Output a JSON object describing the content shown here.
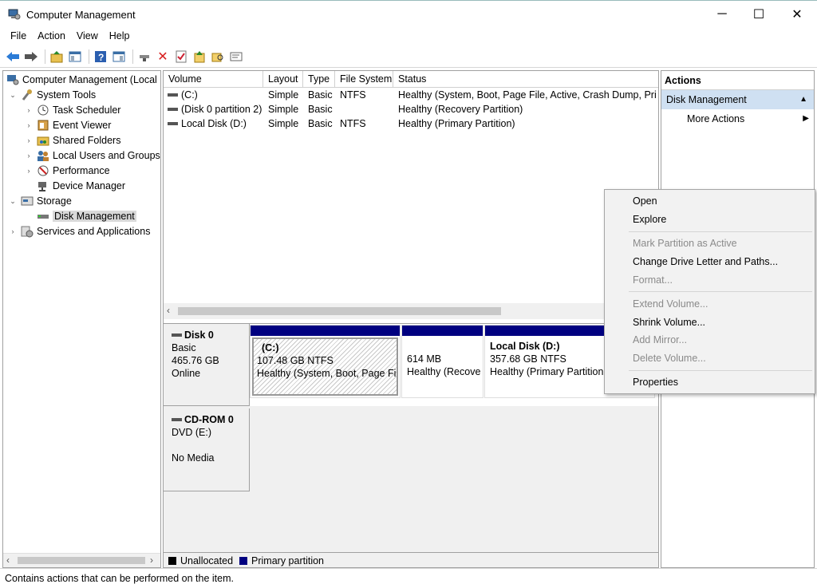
{
  "window": {
    "title": "Computer Management",
    "controls": {
      "minimize": "─",
      "maximize": "☐",
      "close": "✕"
    }
  },
  "menu": [
    "File",
    "Action",
    "View",
    "Help"
  ],
  "tree": {
    "root": "Computer Management (Local",
    "items": [
      {
        "label": "System Tools",
        "expander": "⌄",
        "icon": "tools-icon"
      },
      {
        "label": "Task Scheduler",
        "expander": "›",
        "icon": "clock-icon"
      },
      {
        "label": "Event Viewer",
        "expander": "›",
        "icon": "event-log-icon"
      },
      {
        "label": "Shared Folders",
        "expander": "›",
        "icon": "shared-folder-icon"
      },
      {
        "label": "Local Users and Groups",
        "expander": "›",
        "icon": "users-icon"
      },
      {
        "label": "Performance",
        "expander": "›",
        "icon": "performance-icon"
      },
      {
        "label": "Device Manager",
        "expander": "",
        "icon": "device-manager-icon"
      },
      {
        "label": "Storage",
        "expander": "⌄",
        "icon": "storage-icon"
      },
      {
        "label": "Disk Management",
        "expander": "",
        "icon": "disk-icon"
      },
      {
        "label": "Services and Applications",
        "expander": "›",
        "icon": "services-icon"
      }
    ]
  },
  "volume_table": {
    "columns": [
      "Volume",
      "Layout",
      "Type",
      "File System",
      "Status"
    ],
    "rows": [
      {
        "volume": "(C:)",
        "layout": "Simple",
        "type": "Basic",
        "fs": "NTFS",
        "status": "Healthy (System, Boot, Page File, Active, Crash Dump, Prim"
      },
      {
        "volume": "(Disk 0 partition 2)",
        "layout": "Simple",
        "type": "Basic",
        "fs": "",
        "status": "Healthy (Recovery Partition)"
      },
      {
        "volume": "Local Disk (D:)",
        "layout": "Simple",
        "type": "Basic",
        "fs": "NTFS",
        "status": "Healthy (Primary Partition)"
      }
    ]
  },
  "disks": [
    {
      "name": "Disk 0",
      "type": "Basic",
      "size": "465.76 GB",
      "state": "Online",
      "partitions": [
        {
          "title": "(C:)",
          "size": "107.48 GB NTFS",
          "status": "Healthy (System, Boot, Page File"
        },
        {
          "title": "",
          "size": "614 MB",
          "status": "Healthy (Recove"
        },
        {
          "title": "Local Disk  (D:)",
          "size": "357.68 GB NTFS",
          "status": "Healthy (Primary Partition"
        }
      ]
    },
    {
      "name": "CD-ROM 0",
      "type": "DVD (E:)",
      "size": "",
      "state": "No Media"
    }
  ],
  "legend": [
    {
      "label": "Unallocated",
      "color": "#000000"
    },
    {
      "label": "Primary partition",
      "color": "#000080"
    }
  ],
  "actions": {
    "header": "Actions",
    "section": "Disk Management",
    "more": "More Actions"
  },
  "context_menu": {
    "items": [
      {
        "label": "Open",
        "enabled": true
      },
      {
        "label": "Explore",
        "enabled": true
      },
      {
        "label": "Mark Partition as Active",
        "enabled": false
      },
      {
        "label": "Change Drive Letter and Paths...",
        "enabled": true
      },
      {
        "label": "Format...",
        "enabled": false
      },
      {
        "label": "Extend Volume...",
        "enabled": false
      },
      {
        "label": "Shrink Volume...",
        "enabled": true
      },
      {
        "label": "Add Mirror...",
        "enabled": false
      },
      {
        "label": "Delete Volume...",
        "enabled": false
      },
      {
        "label": "Properties",
        "enabled": true
      }
    ]
  },
  "status_bar": "Contains actions that can be performed on the item.",
  "colors": {
    "primary_partition": "#000080",
    "selection": "#cfe0f2"
  }
}
